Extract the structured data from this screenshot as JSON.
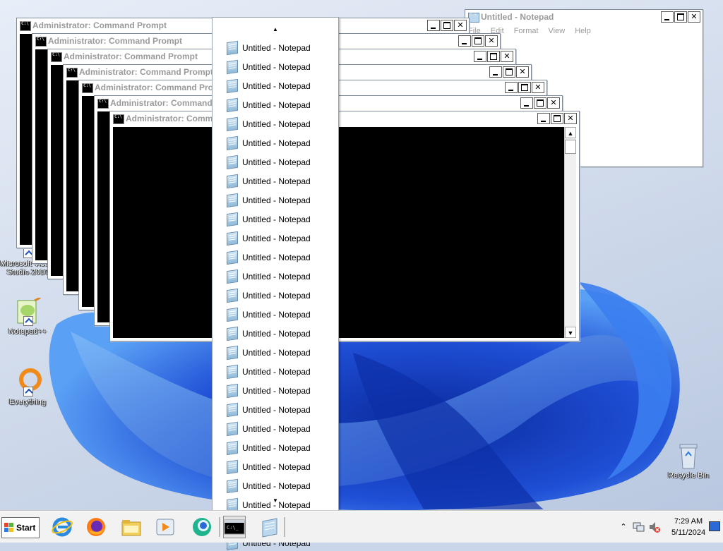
{
  "colors": {
    "wallpaper_blue": "#1f4fd6",
    "console_bg": "#000000",
    "title_text": "#9a9a9a",
    "taskbar_bg": "#f2f2f2"
  },
  "desktop": {
    "icons": [
      {
        "label": "Microsoft Visual Studio 2010",
        "icon": "visual-studio-icon"
      },
      {
        "label": "Notepad++",
        "icon": "notepad-plus-plus-icon"
      },
      {
        "label": "Everything",
        "icon": "everything-search-icon"
      },
      {
        "label": "Recycle Bin",
        "icon": "recycle-bin-icon"
      }
    ]
  },
  "windows": {
    "cmd_title": "Administrator:  Command Prompt",
    "notepad_title": "Untitled - Notepad",
    "notepad_menu": [
      "File",
      "Edit",
      "Format",
      "View",
      "Help"
    ]
  },
  "menu": {
    "item_label": "Untitled - Notepad",
    "items": [
      "Untitled - Notepad",
      "Untitled - Notepad",
      "Untitled - Notepad",
      "Untitled - Notepad",
      "Untitled - Notepad",
      "Untitled - Notepad",
      "Untitled - Notepad",
      "Untitled - Notepad",
      "Untitled - Notepad",
      "Untitled - Notepad",
      "Untitled - Notepad",
      "Untitled - Notepad",
      "Untitled - Notepad",
      "Untitled - Notepad",
      "Untitled - Notepad",
      "Untitled - Notepad",
      "Untitled - Notepad",
      "Untitled - Notepad",
      "Untitled - Notepad",
      "Untitled - Notepad",
      "Untitled - Notepad",
      "Untitled - Notepad",
      "Untitled - Notepad",
      "Untitled - Notepad",
      "Untitled - Notepad",
      "Untitled - Notepad",
      "Untitled - Notepad"
    ]
  },
  "taskbar": {
    "start_label": "Start",
    "pinned": [
      "internet-explorer-icon",
      "firefox-icon",
      "file-explorer-icon",
      "media-player-icon",
      "chat-app-icon"
    ],
    "running": [
      "command-prompt-icon",
      "notepad-icon"
    ],
    "clock_time": "7:29 AM",
    "clock_date": "5/11/2024"
  }
}
